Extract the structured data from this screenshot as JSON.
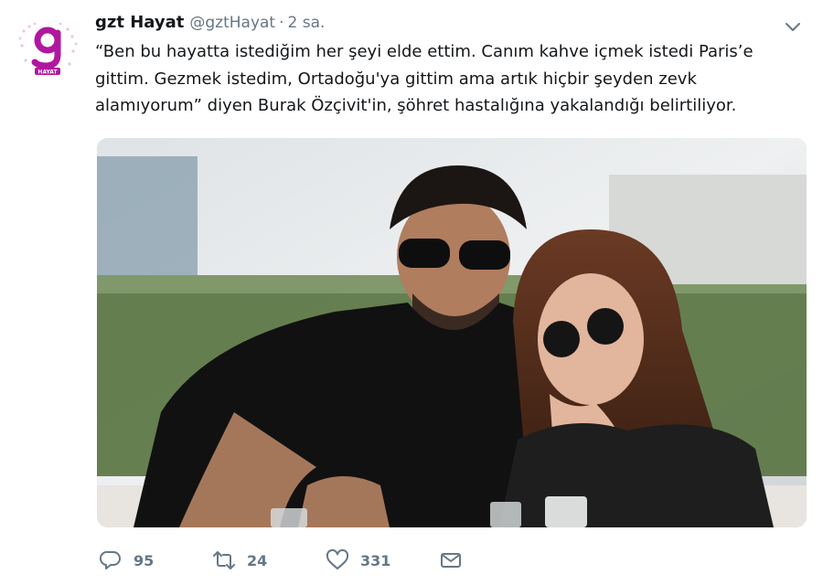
{
  "tweet": {
    "display_name": "gzt Hayat",
    "handle": "@gztHayat",
    "separator": "·",
    "time": "2 sa.",
    "avatar": {
      "logo_letter": "g",
      "logo_text": "HAYAT",
      "color": "#b0179f"
    },
    "text": "“Ben bu hayatta istediğim her şeyi elde ettim. Canım kahve içmek istedi Paris’e gittim. Gezmek istedim, Ortadoğu'ya gittim ama artık hiçbir şeyden zevk alamıyorum” diyen Burak Özçivit'in, şöhret hastalığına yakalandığı belirtiliyor.",
    "media": {
      "kind": "photo",
      "description": "couple-wearing-sunglasses-at-cafe"
    },
    "actions": {
      "reply_count": "95",
      "retweet_count": "24",
      "like_count": "331"
    }
  },
  "icons": [
    "chevron-down-icon",
    "reply-icon",
    "retweet-icon",
    "like-icon",
    "direct-message-icon"
  ],
  "colors": {
    "text": "#14171a",
    "secondary": "#657786",
    "brand": "#b0179f"
  }
}
